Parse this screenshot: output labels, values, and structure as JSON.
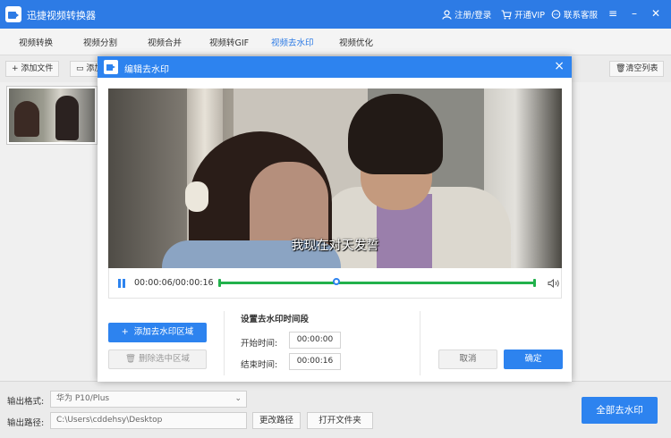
{
  "app": {
    "title": "迅捷视频转换器"
  },
  "titlebar": {
    "register": "注册/登录",
    "vip": "开通VIP",
    "service": "联系客服"
  },
  "tabs": [
    "视频转换",
    "视频分割",
    "视频合并",
    "视频转GIF",
    "视频去水印",
    "视频优化"
  ],
  "active_tab": "视频去水印",
  "toolbar": {
    "add_file": "添加文件",
    "add_folder": "添加文件夹",
    "clear_list": "清空列表"
  },
  "dialog": {
    "title": "编辑去水印",
    "subtitle": "我现在对天发誓",
    "time": "00:00:06/00:00:16",
    "add_region": "添加去水印区域",
    "delete_region": "删除选中区域",
    "section_title": "设置去水印时间段",
    "start_label": "开始时间:",
    "start_value": "00:00:00",
    "end_label": "结束时间:",
    "end_value": "00:00:16",
    "cancel": "取消",
    "confirm": "确定"
  },
  "bottom": {
    "format_label": "输出格式:",
    "format_value": "华为  P10/Plus",
    "path_label": "输出路径:",
    "path_value": "C:\\Users\\cddehsy\\Desktop",
    "change_path": "更改路径",
    "open_folder": "打开文件夹",
    "remove_all": "全部去水印"
  },
  "colors": {
    "primary": "#2d83ef",
    "titlebar": "#2d7be5",
    "timeline": "#22b14c"
  }
}
